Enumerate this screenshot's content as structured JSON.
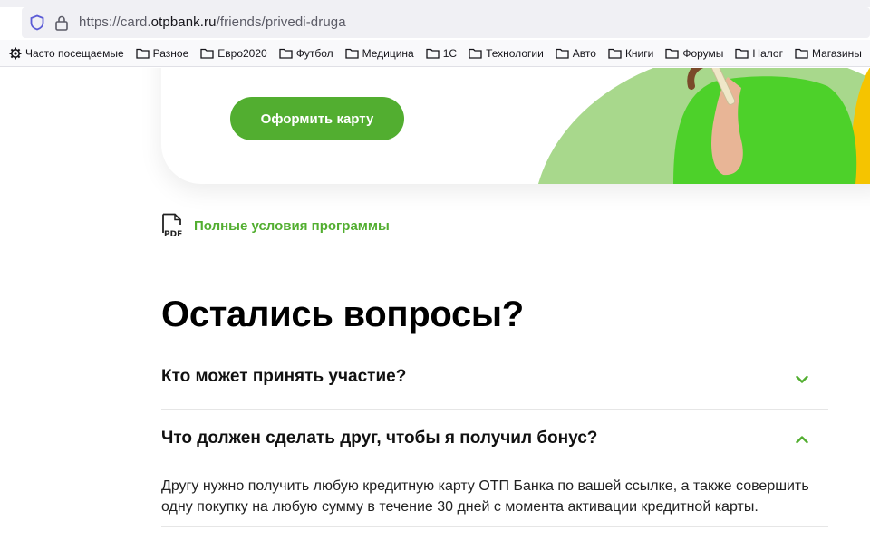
{
  "browser": {
    "url_prefix": "https://card.",
    "url_host": "otpbank.ru",
    "url_path": "/friends/privedi-druga",
    "bookmarks": [
      {
        "label": "Часто посещаемые",
        "icon": "gear-icon"
      },
      {
        "label": "Разное",
        "icon": "folder-icon"
      },
      {
        "label": "Евро2020",
        "icon": "folder-icon"
      },
      {
        "label": "Футбол",
        "icon": "folder-icon"
      },
      {
        "label": "Медицина",
        "icon": "folder-icon"
      },
      {
        "label": "1С",
        "icon": "folder-icon"
      },
      {
        "label": "Технологии",
        "icon": "folder-icon"
      },
      {
        "label": "Авто",
        "icon": "folder-icon"
      },
      {
        "label": "Книги",
        "icon": "folder-icon"
      },
      {
        "label": "Форумы",
        "icon": "folder-icon"
      },
      {
        "label": "Налог",
        "icon": "folder-icon"
      },
      {
        "label": "Магазины",
        "icon": "folder-icon"
      }
    ]
  },
  "hero": {
    "cta_label": "Оформить карту"
  },
  "conditions": {
    "link_label": "Полные условия программы",
    "icon": "pdf-icon",
    "icon_text": "PDF"
  },
  "faq": {
    "title": "Остались вопросы?",
    "items": [
      {
        "question": "Кто может принять участие?",
        "expanded": false,
        "icon": "chevron-down-icon"
      },
      {
        "question": "Что должен сделать друг, чтобы я получил бонус?",
        "expanded": true,
        "icon": "chevron-up-icon",
        "answer": "Другу нужно получить любую кредитную карту ОТП Банка по вашей ссылке, а также совершить одну покупку на любую сумму в течение 30 дней с момента активации кредитной карты."
      }
    ]
  },
  "colors": {
    "brand_green": "#52ae30",
    "light_green": "#a8d88c",
    "shirt_green": "#4dd12a",
    "shirt_yellow": "#f5c400"
  }
}
